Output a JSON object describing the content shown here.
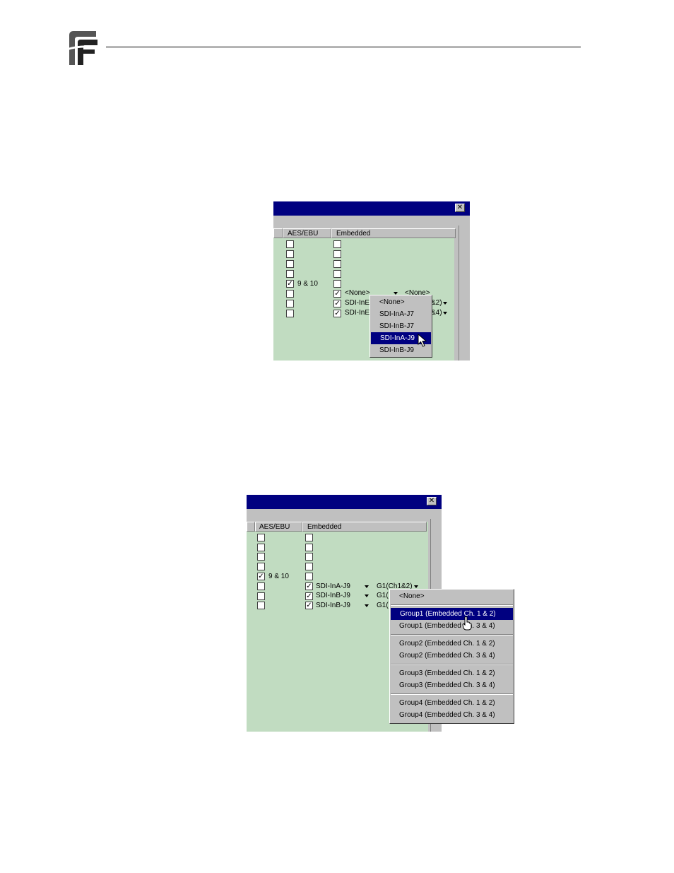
{
  "header": {
    "logo_icon": "company-logo-icon"
  },
  "figure1": {
    "columns": {
      "aes": "AES/EBU",
      "embedded": "Embedded"
    },
    "aes_label": "9 & 10",
    "row5": {
      "source": "<None>",
      "group": "<None>"
    },
    "row6": {
      "source": "SDI-InE",
      "group": "&2)"
    },
    "row7": {
      "source": "SDI-InE",
      "group": "&4)"
    },
    "menu": [
      "<None>",
      "SDI-InA-J7",
      "SDI-InB-J7",
      "SDI-InA-J9",
      "SDI-InB-J9"
    ],
    "menu_selected": "SDI-InA-J9",
    "close_glyph": "✕"
  },
  "figure2": {
    "columns": {
      "aes": "AES/EBU",
      "embedded": "Embedded"
    },
    "aes_label": "9 & 10",
    "row5": {
      "source": "SDI-InA-J9",
      "group": "G1(Ch1&2)"
    },
    "row6": {
      "source": "SDI-InB-J9",
      "group": "G1("
    },
    "row7": {
      "source": "SDI-InB-J9",
      "group": "G1("
    },
    "menu": {
      "none": "<None>",
      "g1a": "Group1 (Embedded Ch. 1 & 2)",
      "g1b": "Group1 (Embedded Ch. 3 & 4)",
      "g2a": "Group2 (Embedded Ch. 1 & 2)",
      "g2b": "Group2 (Embedded Ch. 3 & 4)",
      "g3a": "Group3 (Embedded Ch. 1 & 2)",
      "g3b": "Group3 (Embedded Ch. 3 & 4)",
      "g4a": "Group4 (Embedded Ch. 1 & 2)",
      "g4b": "Group4 (Embedded Ch. 3 & 4)"
    },
    "menu_selected": "Group1 (Embedded Ch. 1 & 2)",
    "close_glyph": "✕"
  },
  "colors": {
    "titlebar": "#000080",
    "panel": "#c1dcc1",
    "chrome": "#c0c0c0",
    "selection": "#000080"
  }
}
